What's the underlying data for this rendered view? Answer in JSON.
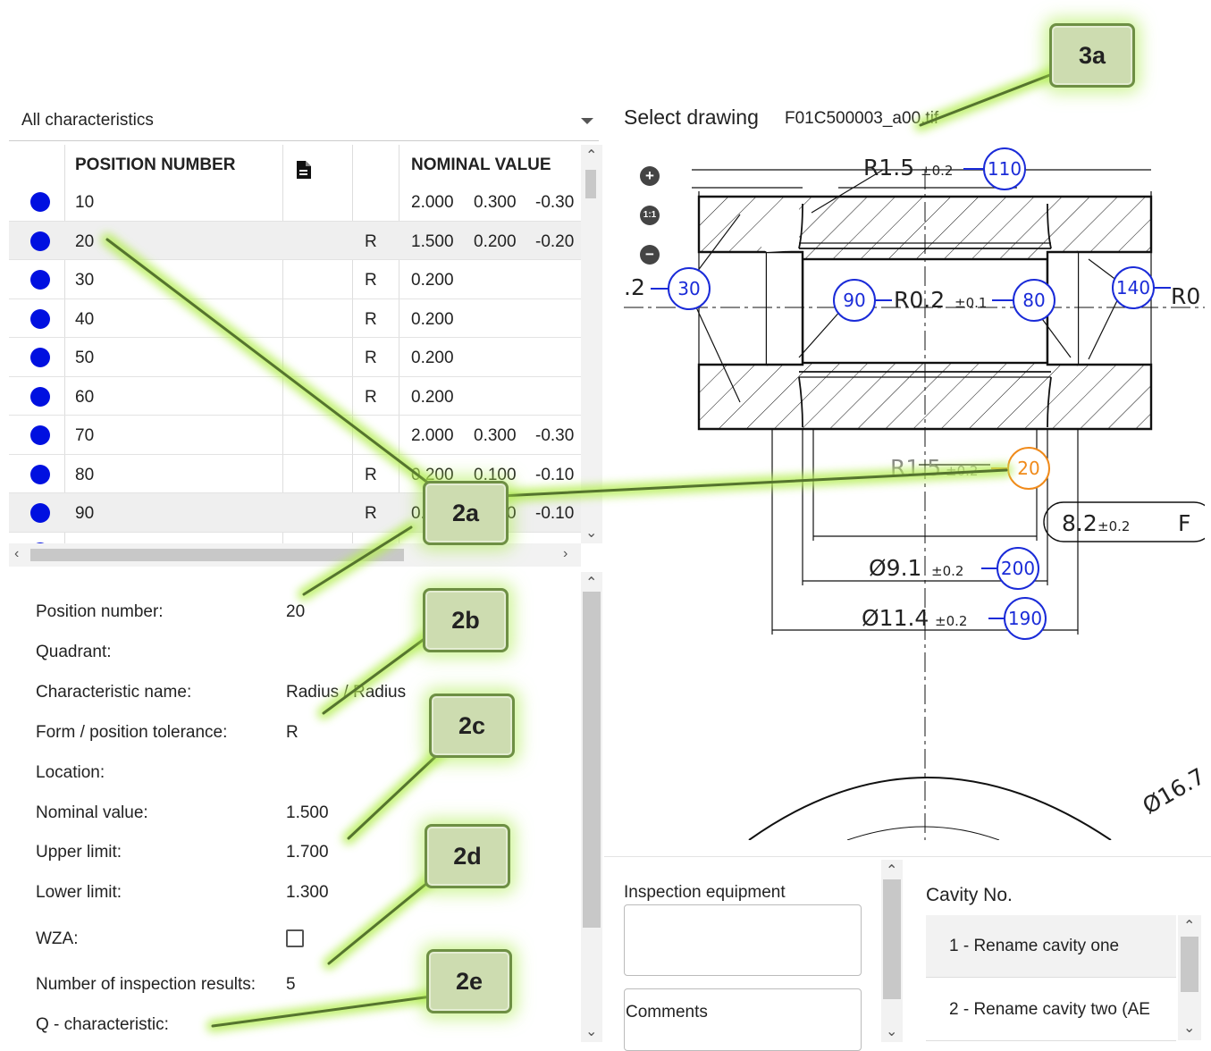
{
  "filter": {
    "label": "All characteristics"
  },
  "table": {
    "columns": [
      "POSITION NUMBER",
      "",
      "NOMINAL VALUE"
    ],
    "header_icon": "document-icon",
    "rows": [
      {
        "pos": "10",
        "tol": "",
        "nom": "2.000",
        "upper": "0.300",
        "lower": "-0.30"
      },
      {
        "pos": "20",
        "tol": "R",
        "nom": "1.500",
        "upper": "0.200",
        "lower": "-0.20"
      },
      {
        "pos": "30",
        "tol": "R",
        "nom": "0.200",
        "upper": "",
        "lower": ""
      },
      {
        "pos": "40",
        "tol": "R",
        "nom": "0.200",
        "upper": "",
        "lower": ""
      },
      {
        "pos": "50",
        "tol": "R",
        "nom": "0.200",
        "upper": "",
        "lower": ""
      },
      {
        "pos": "60",
        "tol": "R",
        "nom": "0.200",
        "upper": "",
        "lower": ""
      },
      {
        "pos": "70",
        "tol": "",
        "nom": "2.000",
        "upper": "0.300",
        "lower": "-0.30"
      },
      {
        "pos": "80",
        "tol": "R",
        "nom": "0.200",
        "upper": "0.100",
        "lower": "-0.10"
      },
      {
        "pos": "90",
        "tol": "R",
        "nom": "0.200",
        "upper": "0.100",
        "lower": "-0.10"
      }
    ],
    "selected_row": 1,
    "status_color": "#0010e0"
  },
  "details": {
    "position_number_label": "Position number:",
    "position_number": "20",
    "quadrant_label": "Quadrant:",
    "characteristic_name_label": "Characteristic name:",
    "characteristic_name": "Radius / Radius",
    "form_tol_label": "Form / position tolerance:",
    "form_tol": "R",
    "location_label": "Location:",
    "nominal_label": "Nominal value:",
    "nominal": "1.500",
    "upper_label": "Upper limit:",
    "upper": "1.700",
    "lower_label": "Lower limit:",
    "lower": "1.300",
    "wza_label": "WZA:",
    "wza_checked": false,
    "results_label": "Number of inspection results:",
    "results": "5",
    "q_label": "Q - characteristic:"
  },
  "drawing": {
    "select_label": "Select drawing",
    "file": "F01C500003_a00.tif",
    "zoom_in": "+",
    "zoom_reset": "1:1",
    "zoom_out": "−",
    "dims": {
      "r15_top": "R1.5",
      "tol_02": "±0.2",
      "r02": "R0.2",
      "tol_01": "±0.1",
      "r15_bottom": "R1.5",
      "dim82": "8.2",
      "dim82_tail": "F",
      "d91": "Ø9.1",
      "d114": "Ø11.4",
      "d167": "Ø16.7",
      "left_frag": ".2",
      "right_frag": "R0"
    },
    "balloons": [
      "110",
      "30",
      "90",
      "80",
      "140",
      "20",
      "200",
      "190"
    ],
    "balloon_color": "#1a2bd8",
    "highlight_color": "#f08a1a"
  },
  "bottom": {
    "inspection_label": "Inspection equipment",
    "comments_label": "Comments",
    "cavity_label": "Cavity No.",
    "cavities": [
      "1 - Rename cavity one",
      "2 - Rename cavity two (AE"
    ]
  },
  "callouts": [
    "3a",
    "2a",
    "2b",
    "2c",
    "2d",
    "2e"
  ]
}
